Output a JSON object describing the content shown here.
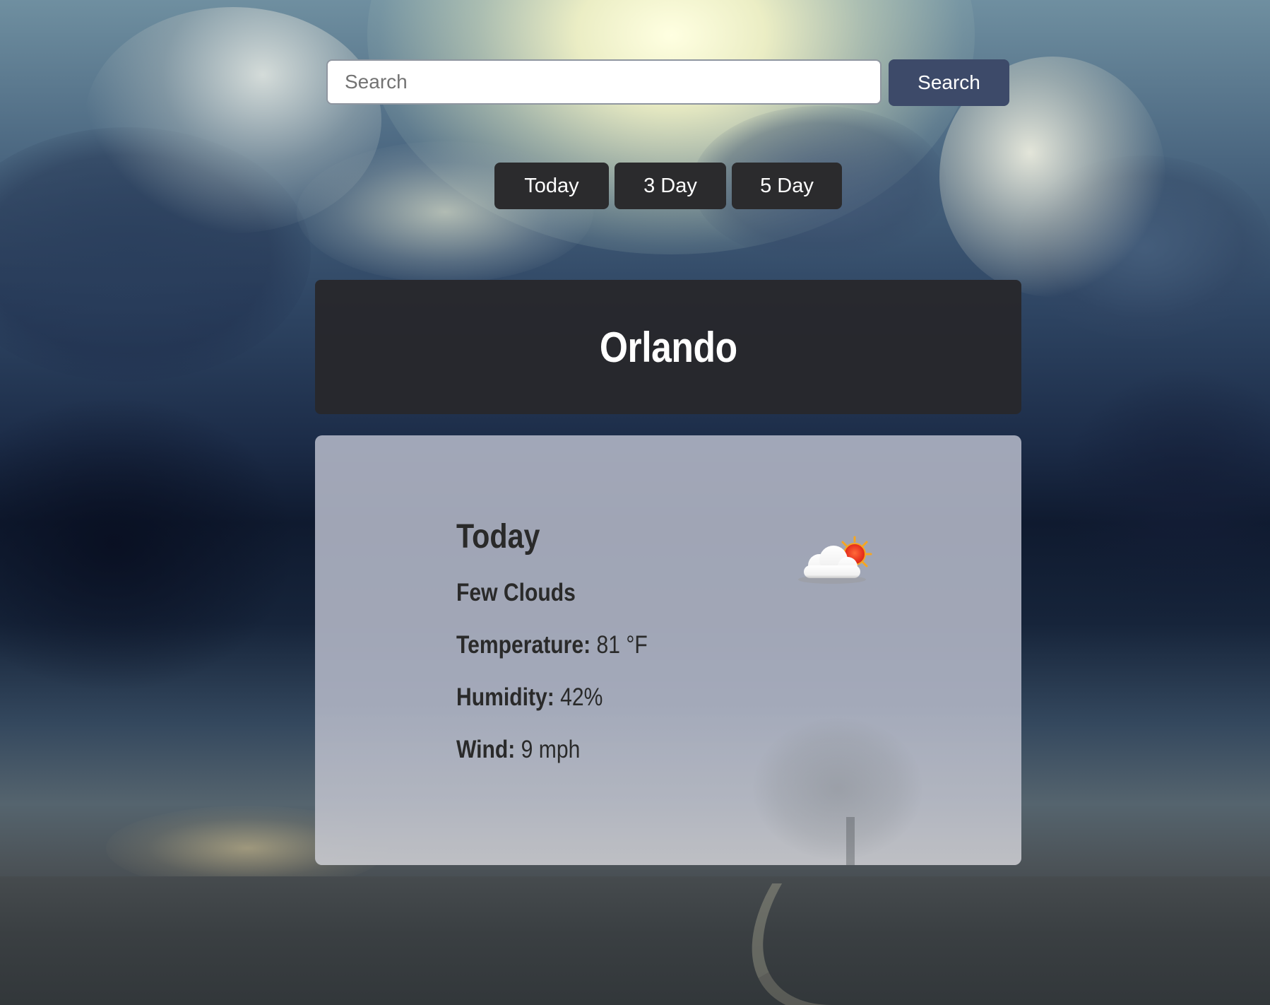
{
  "search": {
    "placeholder": "Search",
    "button_label": "Search"
  },
  "range_tabs": [
    {
      "label": "Today"
    },
    {
      "label": "3 Day"
    },
    {
      "label": "5 Day"
    }
  ],
  "city": {
    "name": "Orlando"
  },
  "forecast": {
    "day": "Today",
    "condition": "Few Clouds",
    "temperature_label": "Temperature:",
    "temperature_value": "81 °F",
    "humidity_label": "Humidity:",
    "humidity_value": "42%",
    "wind_label": "Wind:",
    "wind_value": "9 mph",
    "icon": "few-clouds-icon"
  },
  "colors": {
    "search_button": "#3d4a69",
    "range_button": "#2b2b2d",
    "city_header": "#28282c",
    "card": "#b0b5c4"
  }
}
